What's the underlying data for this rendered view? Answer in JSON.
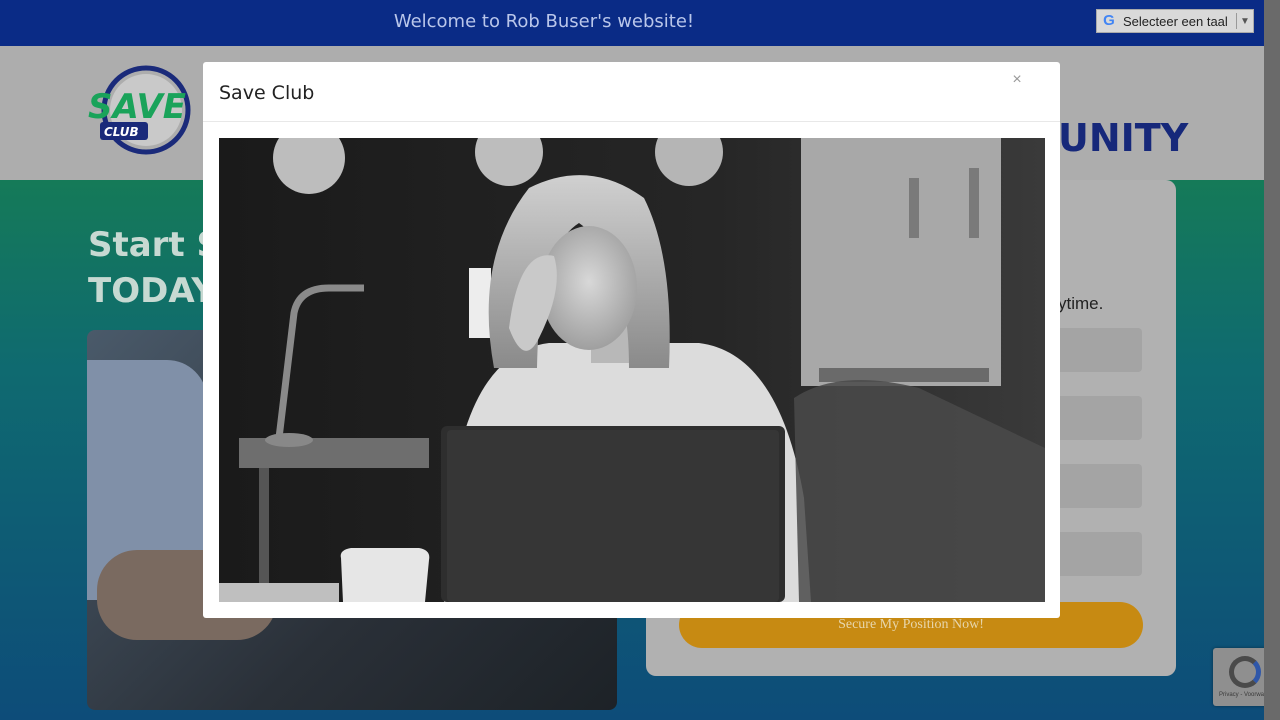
{
  "topbar": {
    "welcome": "Welcome to Rob Buser's website!"
  },
  "translate": {
    "label": "Selecteer een taal",
    "google_glyph": "G",
    "arrow": "▼"
  },
  "header": {
    "logo_main": "SAVE",
    "logo_sub": "CLUB",
    "community_fragment": "UNITY"
  },
  "hero": {
    "start_line1": "Start S",
    "start_line2": "TODAY"
  },
  "card": {
    "anytime_fragment": "ytime.",
    "cta_label": "Secure My Position Now!"
  },
  "recaptcha": {
    "footer": "Privacy - Voorwaarden"
  },
  "modal": {
    "title": "Save Club",
    "close": "×"
  },
  "colors": {
    "topbar": "#0a2b86",
    "community": "#16287a",
    "cta": "#c78a12",
    "logo_green": "#1aa35a"
  }
}
